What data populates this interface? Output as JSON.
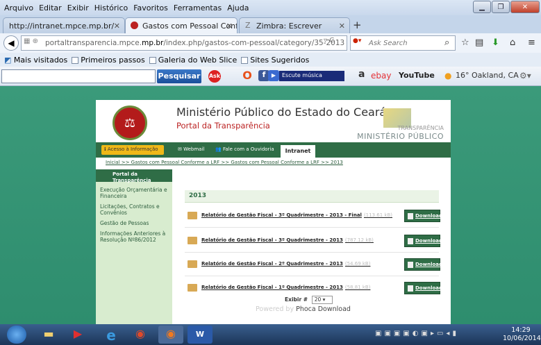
{
  "menu": [
    "Arquivo",
    "Editar",
    "Exibir",
    "Histórico",
    "Favoritos",
    "Ferramentas",
    "Ajuda"
  ],
  "tabs": [
    {
      "label": "http://intranet.mpce.mp.br/"
    },
    {
      "label": "Gastos com Pessoal Confor..."
    },
    {
      "label": "Zimbra: Escrever"
    }
  ],
  "url": {
    "host": "portaltransparencia.mpce.",
    "domain": "mp.br",
    "path": "/index.php/gastos-com-pessoal/category/35-2013"
  },
  "search_placeholder": "Ask Search",
  "bookmarks": [
    "Mais visitados",
    "Primeiros passos",
    "Galeria do Web Slice",
    "Sites Sugeridos"
  ],
  "toolbar": {
    "search_button": "Pesquisar",
    "music": "Escute música",
    "ebay": "ebay",
    "youtube": "YouTube",
    "weather": "16° Oakland, CA"
  },
  "site": {
    "title": "Ministério Público do Estado do Ceará",
    "subtitle": "Portal da Transparência",
    "logo_top": "TRANSPARÊNCIA",
    "logo_bottom": "MINISTÉRIO PÚBLICO",
    "nav": {
      "acesso": "Acesso à Informação",
      "webmail": "Webmail",
      "ouvidoria": "Fale com a Ouvidoria",
      "intranet": "Intranet"
    },
    "breadcrumb": "Inicial >> Gastos com Pessoal Conforme a LRF >> Gastos com Pessoal Conforme a LRF >> 2013",
    "sidebar_head": "Portal da Transparência",
    "sidebar_items": [
      "Execução Orçamentária e Financeira",
      "Licitações, Contratos e Convênios",
      "Gestão de Pessoas",
      "Informações Anteriores à Resolução Nº86/2012"
    ],
    "year": "2013",
    "docs": [
      {
        "title": "Relatório de Gestão Fiscal - 3º Quadrimestre - 2013 - Final",
        "size": "(113.61 kB)"
      },
      {
        "title": "Relatório de Gestão Fiscal - 3º Quadrimestre - 2013",
        "size": "(787.12 kB)"
      },
      {
        "title": "Relatório de Gestão Fiscal - 2º Quadrimestre - 2013",
        "size": "(54.69 kB)"
      },
      {
        "title": "Relatório de Gestão Fiscal - 1º Quadrimestre - 2013",
        "size": "(58.81 kB)"
      }
    ],
    "download_label": "Download",
    "pager_label": "Exibir #",
    "pager_value": "20",
    "powered_prefix": "Powered by",
    "powered_name": "Phoca Download"
  },
  "clock": {
    "time": "14:29",
    "date": "10/06/2014"
  }
}
